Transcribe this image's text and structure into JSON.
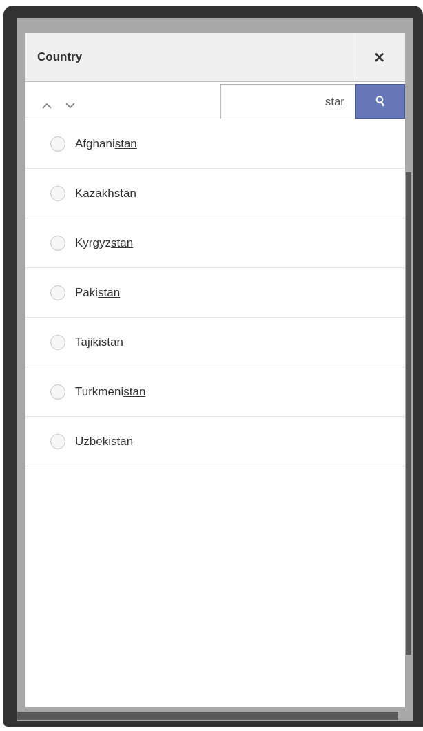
{
  "dialog": {
    "title": "Country",
    "close_label": "×"
  },
  "search": {
    "value": "star"
  },
  "options": [
    {
      "before": "Afghani",
      "match": "stan",
      "selected": false
    },
    {
      "before": "Kazakh",
      "match": "stan",
      "selected": false
    },
    {
      "before": "Kyrgyz",
      "match": "stan",
      "selected": false
    },
    {
      "before": "Paki",
      "match": "stan",
      "selected": false
    },
    {
      "before": "Tajiki",
      "match": "stan",
      "selected": false
    },
    {
      "before": "Turkmeni",
      "match": "stan",
      "selected": false
    },
    {
      "before": "Uzbeki",
      "match": "stan",
      "selected": false
    }
  ]
}
